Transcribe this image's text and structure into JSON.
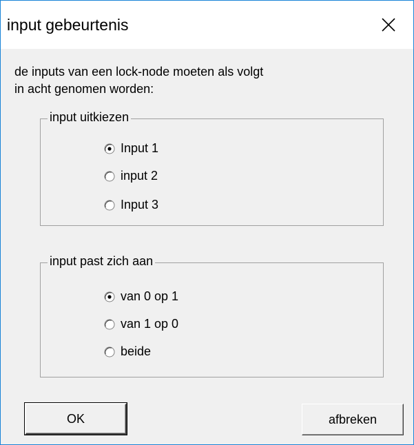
{
  "window": {
    "title": "input gebeurtenis",
    "close_icon": "close-icon"
  },
  "description": "de inputs van een lock-node moeten als volgt\nin acht genomen worden:",
  "group_input": {
    "legend": "input uitkiezen",
    "options": [
      "Input 1",
      "input 2",
      "Input 3"
    ],
    "selected_index": 0
  },
  "group_change": {
    "legend": "input past zich aan",
    "options": [
      "van 0 op 1",
      "van 1 op 0",
      "beide"
    ],
    "selected_index": 0
  },
  "buttons": {
    "ok_label": "OK",
    "cancel_label": "afbreken"
  },
  "colors": {
    "window_border": "#1883d7",
    "dialog_bg": "#f0f0f0"
  }
}
